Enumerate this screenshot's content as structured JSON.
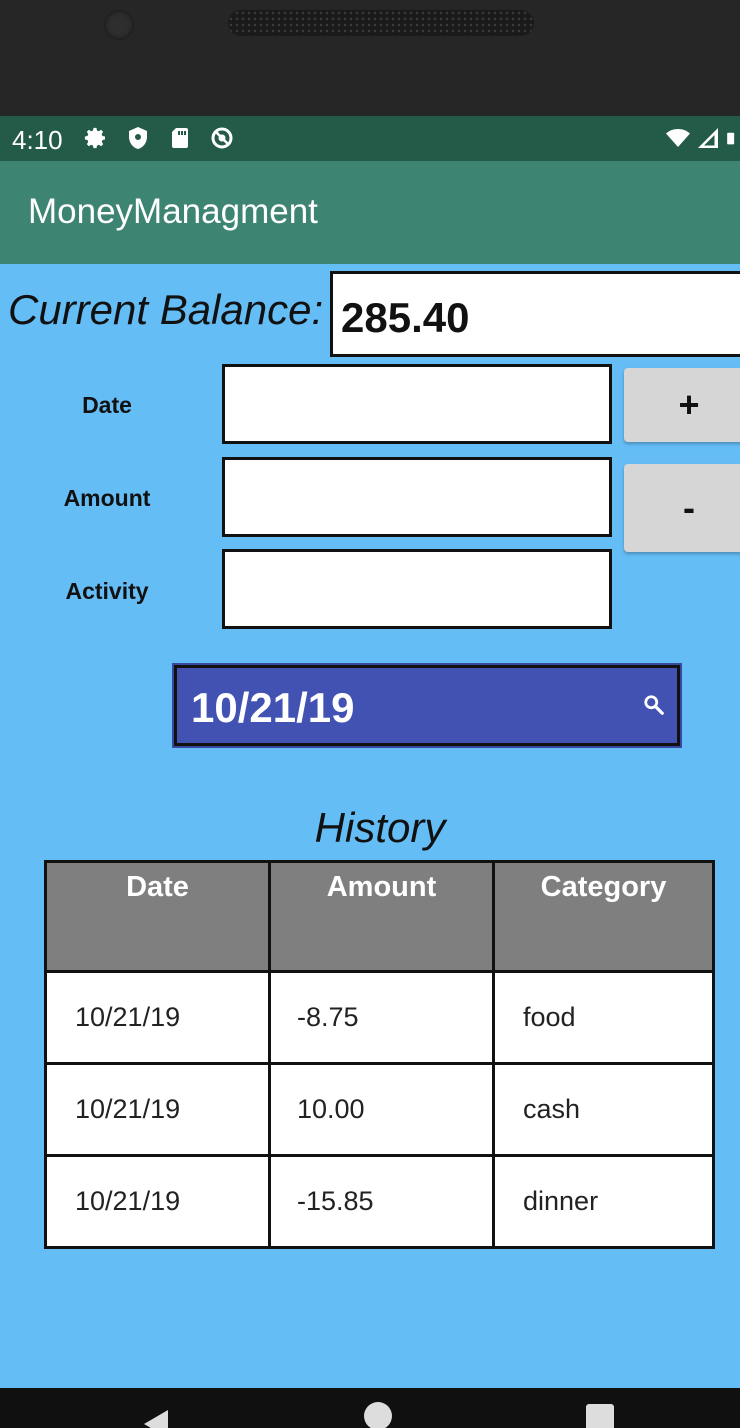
{
  "status_bar": {
    "time": "4:10",
    "left_icons": [
      "gear-icon",
      "shield-icon",
      "sd-card-icon",
      "sync-icon"
    ],
    "right_icons": [
      "wifi-icon",
      "signal-icon",
      "battery-icon"
    ]
  },
  "app_bar": {
    "title": "MoneyManagment"
  },
  "balance": {
    "label": "Current Balance:",
    "value": "285.40"
  },
  "form": {
    "date_label": "Date",
    "amount_label": "Amount",
    "activity_label": "Activity",
    "date_value": "",
    "amount_value": "",
    "activity_value": ""
  },
  "buttons": {
    "add_label": "+",
    "subtract_label": "-"
  },
  "date_picker": {
    "value": "10/21/19",
    "icon": "search-icon"
  },
  "history": {
    "title": "History",
    "columns": [
      "Date",
      "Amount",
      "Category"
    ],
    "rows": [
      [
        "10/21/19",
        "-8.75",
        "food"
      ],
      [
        "10/21/19",
        "10.00",
        "cash"
      ],
      [
        "10/21/19",
        "-15.85",
        "dinner"
      ]
    ]
  },
  "colors": {
    "content_bg": "#65bdf6",
    "app_bar": "#3e8473",
    "status_bar": "#245a48",
    "date_picker": "#4152b2",
    "table_header": "#7f7f7f"
  }
}
